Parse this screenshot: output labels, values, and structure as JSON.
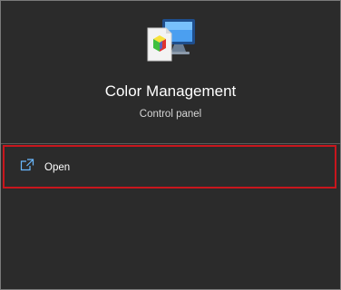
{
  "app": {
    "icon": "color-management-icon",
    "title": "Color Management",
    "subtitle": "Control panel"
  },
  "actions": [
    {
      "label": "Open",
      "icon": "open-icon"
    }
  ],
  "colors": {
    "background": "#2b2b2b",
    "highlight_border": "#c8161d",
    "text_primary": "#ffffff",
    "text_secondary": "#d6d6d6",
    "divider": "#5a5a5a"
  }
}
